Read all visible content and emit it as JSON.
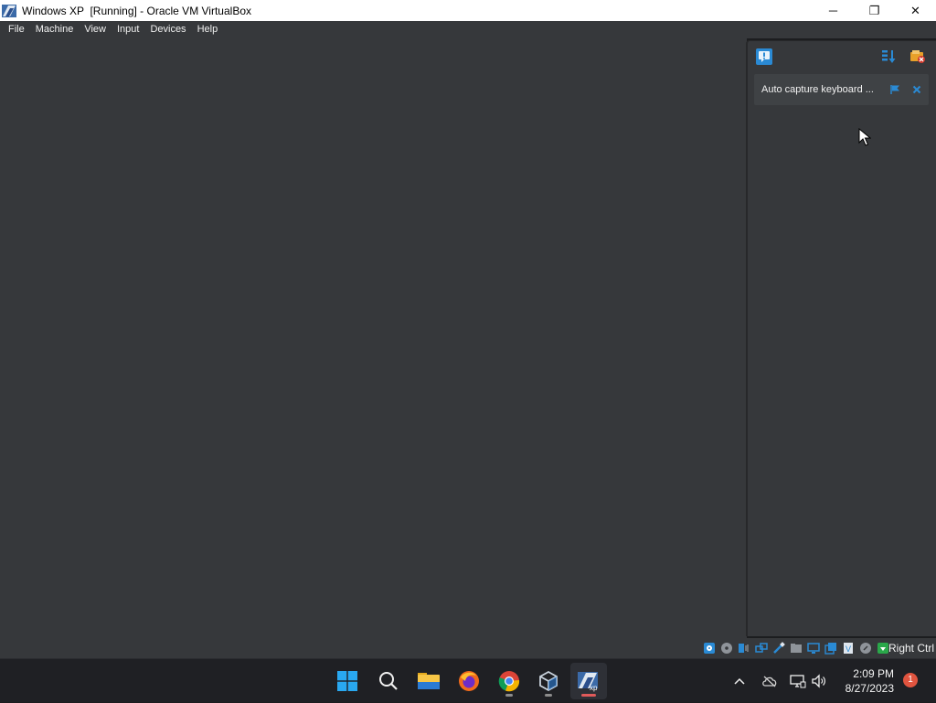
{
  "window": {
    "title": "Windows XP  [Running] - Oracle VM VirtualBox",
    "app_icon": "virtualbox-xp-icon",
    "controls": {
      "minimize": "─",
      "maximize": "❐",
      "close": "✕"
    }
  },
  "menu": {
    "items": [
      "File",
      "Machine",
      "View",
      "Input",
      "Devices",
      "Help"
    ]
  },
  "notification_center": {
    "toolbar_icons": [
      "notification-center-icon",
      "sort-icon",
      "keep-finished-icon"
    ],
    "items": [
      {
        "text": "Auto capture keyboard ...",
        "actions": [
          "flag-icon",
          "close-icon"
        ]
      }
    ]
  },
  "statusbar": {
    "icons": [
      "hard-disk-icon",
      "optical-drive-icon",
      "audio-icon",
      "network-icon",
      "usb-icon",
      "shared-folders-icon",
      "display-icon",
      "recording-icon",
      "vt-x-icon",
      "mouse-integration-icon",
      "keyboard-icon"
    ],
    "host_key": "Right Ctrl"
  },
  "taskbar": {
    "apps": [
      "start-icon",
      "search-icon",
      "file-explorer-icon",
      "firefox-icon",
      "chrome-icon",
      "virtualbox-icon",
      "windows-xp-vm-icon"
    ],
    "tray": [
      "show-hidden-icons-icon",
      "onedrive-icon",
      "network-icon",
      "volume-icon"
    ],
    "time": "2:09 PM",
    "date": "8/27/2023",
    "notification_count": "1"
  },
  "colors": {
    "vm_background": "#36383b",
    "menubar": "#36383b",
    "taskbar": "#1f2024",
    "accent_blue": "#2a8ad4",
    "badge": "#e0543f"
  }
}
